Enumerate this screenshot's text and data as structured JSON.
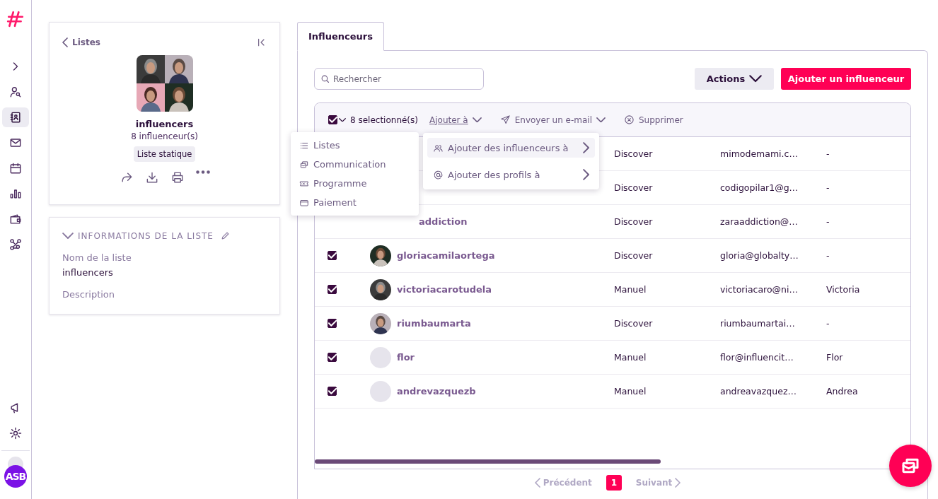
{
  "sidebar": {
    "items": [
      {
        "selected": false
      },
      {
        "selected": false
      },
      {
        "selected": true
      },
      {
        "selected": false
      },
      {
        "selected": false
      },
      {
        "selected": false
      },
      {
        "selected": false
      },
      {
        "selected": false
      }
    ],
    "bottom_items": [
      {
        "selected": false
      },
      {
        "selected": false
      }
    ],
    "user_initials": "ASB"
  },
  "list_card": {
    "back_label": "Listes",
    "name": "influencers",
    "count": "8 influenceur(s)",
    "badge": "Liste statique"
  },
  "info_card": {
    "title": "INFORMATIONS DE LA LISTE",
    "expanded": true,
    "fields": [
      {
        "label": "Nom de la liste",
        "value": "influencers"
      },
      {
        "label": "Description"
      }
    ]
  },
  "tabs": [
    {
      "label": "Influenceurs",
      "selected": true
    }
  ],
  "search": {
    "placeholder": "Rechercher"
  },
  "actions_button": "Actions",
  "add_button": "Ajouter un influenceur",
  "toolbar": {
    "all_checked": true,
    "selected_count": "8 selectionné(s)",
    "items": [
      {
        "label": "Ajouter à",
        "caret": true,
        "open": true
      },
      {
        "label": "Envoyer un e-mail",
        "caret": true,
        "open": false
      },
      {
        "label": "Supprimer",
        "caret": false,
        "open": false
      }
    ]
  },
  "rows": [
    {
      "kind": "covered",
      "source": "Discover",
      "email": "mimodemami.c…",
      "first_name": "-"
    },
    {
      "kind": "covered",
      "source": "Discover",
      "email": "codigopilar1@g…",
      "first_name": "-"
    },
    {
      "kind": "covered",
      "name": "addiction",
      "source": "Discover",
      "email": "zaraaddiction@…",
      "first_name": "-"
    },
    {
      "checked": true,
      "name": "gloriacamilaortega",
      "source": "Discover",
      "email": "gloria@globalty…",
      "first_name": "-"
    },
    {
      "checked": true,
      "name": "victoriacarotudela",
      "source": "Manuel",
      "email": "victoriacaro@ni…",
      "first_name": "Victoria"
    },
    {
      "checked": true,
      "name": "riumbaumarta",
      "source": "Discover",
      "email": "riumbaumartai…",
      "first_name": "-"
    },
    {
      "kind": "default",
      "checked": true,
      "name": "flor",
      "source": "Manuel",
      "email": "flor@influencit…",
      "first_name": "Flor"
    },
    {
      "kind": "default",
      "checked": true,
      "name": "andrevazquezb",
      "source": "Manuel",
      "email": "andreavazquez…",
      "first_name": "Andrea"
    }
  ],
  "menu": {
    "items": [
      {
        "label": "Listes"
      },
      {
        "label": "Communication"
      },
      {
        "label": "Programme"
      },
      {
        "label": "Paiement"
      }
    ]
  },
  "submenu": {
    "items": [
      {
        "label": "Ajouter des influenceurs à",
        "selected": true
      },
      {
        "label": "Ajouter des profils à",
        "selected": false
      }
    ]
  },
  "pagination": {
    "prev": "Précédent",
    "pages": [
      {
        "label": "1",
        "selected": true
      }
    ],
    "next": "Suivant"
  }
}
